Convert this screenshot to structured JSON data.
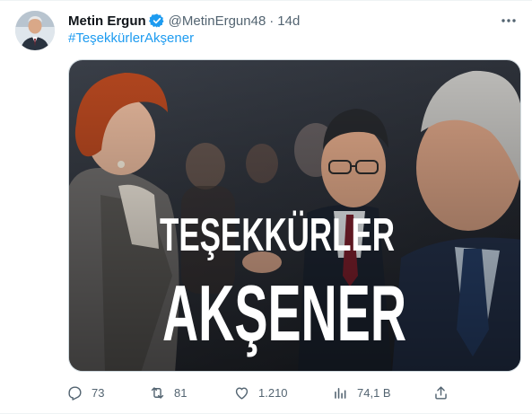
{
  "tweet": {
    "author_name": "Metin Ergun",
    "handle": "@MetinErgun48",
    "separator": "·",
    "time": "14d",
    "hashtag": "#TeşekkürlerAkşener"
  },
  "media": {
    "overlay_line1": "TEŞEKKÜRLER",
    "overlay_line2": "AKŞENER"
  },
  "actions": {
    "replies": "73",
    "retweets": "81",
    "likes": "1.210",
    "views": "74,1 B"
  },
  "colors": {
    "accent": "#1d9bf0",
    "text_secondary": "#536471",
    "verified": "#1d9bf0"
  },
  "icons": [
    "verified-badge-icon",
    "more-icon",
    "reply-icon",
    "retweet-icon",
    "like-icon",
    "views-icon",
    "share-icon"
  ]
}
